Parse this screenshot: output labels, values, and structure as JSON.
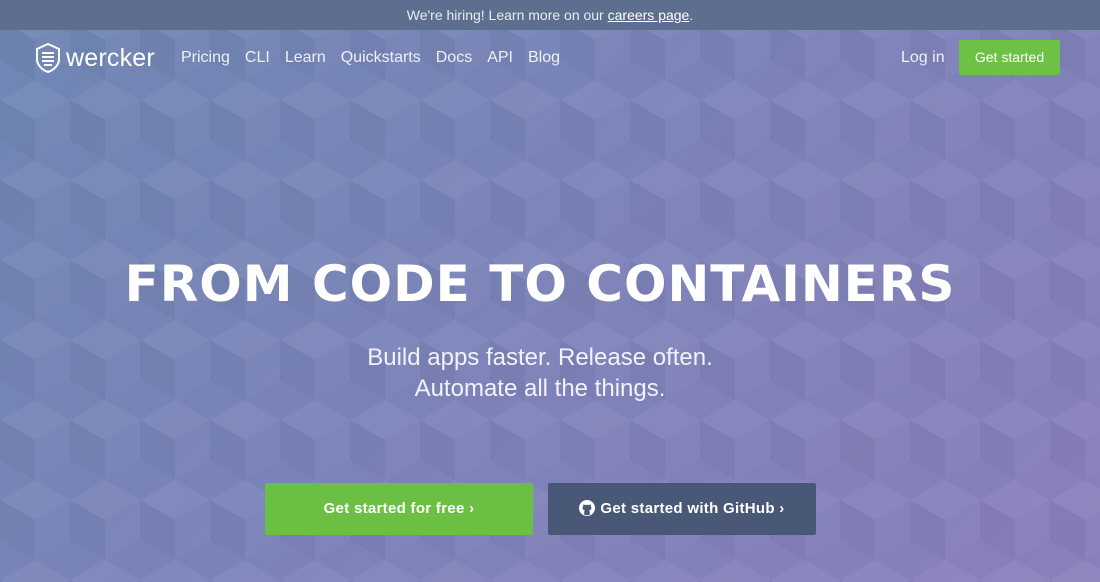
{
  "banner": {
    "text": "We're hiring! Learn more on our",
    "link": "careers page",
    "end": "."
  },
  "brand": {
    "name": "wercker",
    "icon": "wercker-shield-icon"
  },
  "nav": {
    "links": [
      "Pricing",
      "CLI",
      "Learn",
      "Quickstarts",
      "Docs",
      "API",
      "Blog"
    ],
    "login": "Log in",
    "cta": "Get started"
  },
  "hero": {
    "title": "FROM CODE TO CONTAINERS",
    "sub_line1": "Build apps faster. Release often.",
    "sub_line2": "Automate all the things."
  },
  "buttons": {
    "free": "Get started for free ›",
    "github": "Get started with GitHub ›",
    "github_icon": "github-icon"
  },
  "colors": {
    "accent_green": "#6bc044",
    "github_button": "#4a5877",
    "banner_bg": "#5d6e8e"
  }
}
